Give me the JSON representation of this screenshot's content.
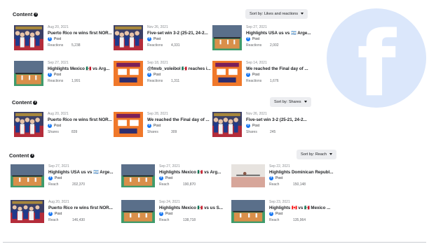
{
  "sections": [
    {
      "title": "Content",
      "sort_label": "Sort by: Likes and reactions",
      "items": [
        {
          "date": "Aug 20, 2021",
          "title": "Puerto Rico re wins first NOR...",
          "type": "Post",
          "metric_label": "Reactions",
          "metric_value": "5,238",
          "thumb": "celebration"
        },
        {
          "date": "Nov 26, 2021",
          "title": "Five-set win 3-2 (25-21, 24-2...",
          "type": "Post",
          "metric_label": "Reactions",
          "metric_value": "4,331",
          "thumb": "celebration"
        },
        {
          "date": "Sep 27, 2021",
          "title": "Highlights USA us vs 🇦🇷 Arge...",
          "type": "Post",
          "metric_label": "Reactions",
          "metric_value": "2,002",
          "thumb": "court"
        },
        {
          "date": "Sep 27, 2021",
          "title": "Highlights Mexico 🇲🇽 vs Arg...",
          "type": "Post",
          "metric_label": "Reactions",
          "metric_value": "1,991",
          "thumb": "court"
        },
        {
          "date": "Sep 18, 2021",
          "title": "@fmvb_voleibol 🇲🇽 reaches i...",
          "type": "Post",
          "metric_label": "Reactions",
          "metric_value": "1,311",
          "thumb": "graphic"
        },
        {
          "date": "Sep 14, 2021",
          "title": "We reached the Final day of ...",
          "type": "Post",
          "metric_label": "Reactions",
          "metric_value": "1,676",
          "thumb": "graphic"
        }
      ]
    },
    {
      "title": "Content",
      "sort_label": "Sort by: Shares",
      "items": [
        {
          "date": "Aug 20, 2021",
          "title": "Puerto Rico re wins first NOR...",
          "type": "Post",
          "metric_label": "Shares",
          "metric_value": "839",
          "thumb": "celebration"
        },
        {
          "date": "Sep 28, 2021",
          "title": "We reached the Final day of ...",
          "type": "Post",
          "metric_label": "Shares",
          "metric_value": "309",
          "thumb": "graphic"
        },
        {
          "date": "Nov 26, 2021",
          "title": "Five-set win 3-2 (25-21, 24-2...",
          "type": "Post",
          "metric_label": "Shares",
          "metric_value": "245",
          "thumb": "celebration"
        }
      ]
    },
    {
      "title": "Content",
      "sort_label": "Sort by: Reach",
      "items": [
        {
          "date": "Sep 27, 2021",
          "title": "Highlights USA us vs 🇦🇷 Arge...",
          "type": "Post",
          "metric_label": "Reach",
          "metric_value": "202,370",
          "thumb": "court"
        },
        {
          "date": "Sep 27, 2021",
          "title": "Highlights Mexico 🇲🇽 vs Arg...",
          "type": "Post",
          "metric_label": "Reach",
          "metric_value": "190,870",
          "thumb": "court"
        },
        {
          "date": "Sep 22, 2021",
          "title": "Highlights Dominican Republ...",
          "type": "Post",
          "metric_label": "Reach",
          "metric_value": "150,148",
          "thumb": "court-light"
        },
        {
          "date": "Aug 20, 2021",
          "title": "Puerto Rico re wins first NOR...",
          "type": "Post",
          "metric_label": "Reach",
          "metric_value": "146,430",
          "thumb": "celebration"
        },
        {
          "date": "Sep 24, 2021",
          "title": "Highlights Mexico 🇲🇽 vs us S...",
          "type": "Post",
          "metric_label": "Reach",
          "metric_value": "138,718",
          "thumb": "court"
        },
        {
          "date": "Sep 23, 2021",
          "title": "Highlights 🇨🇦 vs 🇲🇽 Mexico ...",
          "type": "Post",
          "metric_label": "Reach",
          "metric_value": "135,964",
          "thumb": "court"
        }
      ]
    }
  ],
  "colors": {
    "facebook_blue": "#1877f2",
    "watermark": "#dbe7fb",
    "sort_button": "#ecedf0"
  },
  "icons": {
    "info": "info-icon",
    "facebook": "facebook-icon",
    "watermark": "facebook-logo-watermark",
    "sort_caret": "caret-down-icon"
  }
}
